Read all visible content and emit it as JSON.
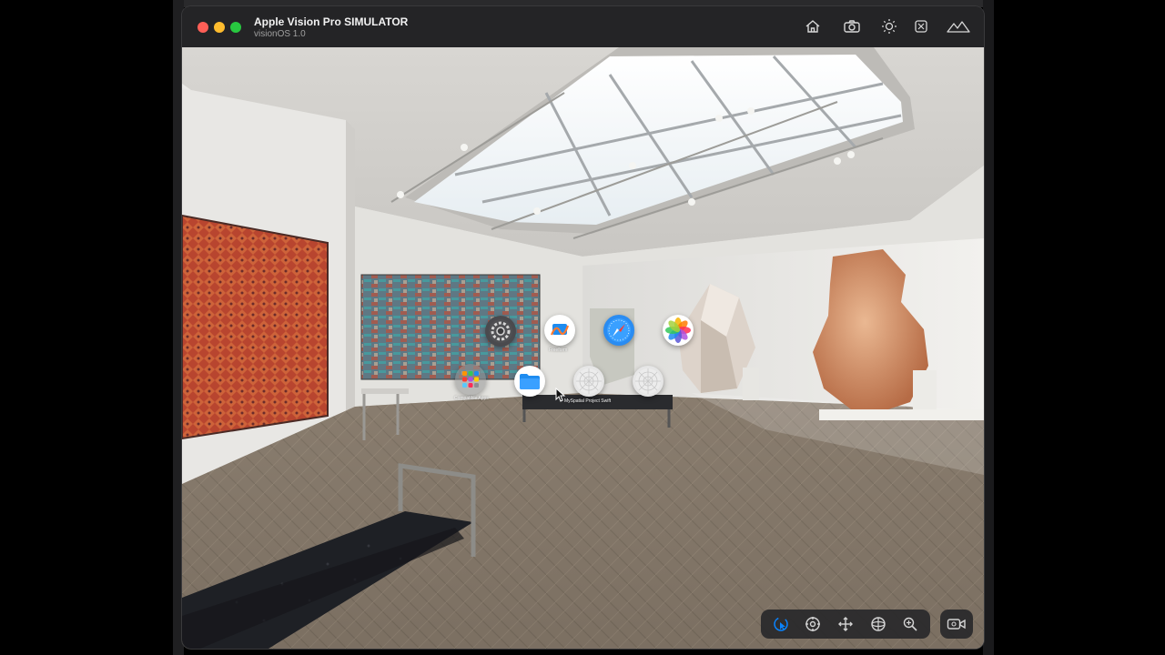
{
  "window": {
    "title": "Apple Vision Pro SIMULATOR",
    "subtitle": "visionOS 1.0"
  },
  "titlebar_buttons": [
    {
      "icon": "home-icon"
    },
    {
      "icon": "camera-icon"
    },
    {
      "icon": "brightness-icon"
    },
    {
      "icon": "device-frame-icon"
    },
    {
      "icon": "environment-mountains-icon"
    }
  ],
  "home_view": {
    "apps": [
      {
        "name": "Settings",
        "icon": "settings-gear-icon"
      },
      {
        "name": "Freeform",
        "icon": "freeform-icon",
        "label": "Freeform"
      },
      {
        "name": "Safari",
        "icon": "safari-compass-icon"
      },
      {
        "name": "Photos",
        "icon": "photos-flower-icon"
      },
      {
        "name": "Compatible Apps",
        "icon": "compatible-apps-folder-icon",
        "label": "Compatible Apps"
      },
      {
        "name": "Files",
        "icon": "files-folder-icon"
      },
      {
        "name": "App",
        "icon": "placeholder-app-icon"
      },
      {
        "name": "App",
        "icon": "placeholder-app-icon",
        "label": "MySpatial Project Swift"
      },
      {
        "name": "App",
        "icon": "placeholder-app-icon"
      }
    ]
  },
  "sim_toolbar": {
    "tools": [
      {
        "icon": "interact-pointer-icon",
        "active": true
      },
      {
        "icon": "look-around-icon",
        "active": false
      },
      {
        "icon": "pan-move-icon",
        "active": false
      },
      {
        "icon": "orbit-icon",
        "active": false
      },
      {
        "icon": "zoom-icon",
        "active": false
      }
    ],
    "record_icon": "record-video-icon"
  },
  "colors": {
    "accent": "#0a84ff",
    "close": "#ff5f57",
    "minimize": "#febc2e",
    "maximize": "#28c840"
  }
}
